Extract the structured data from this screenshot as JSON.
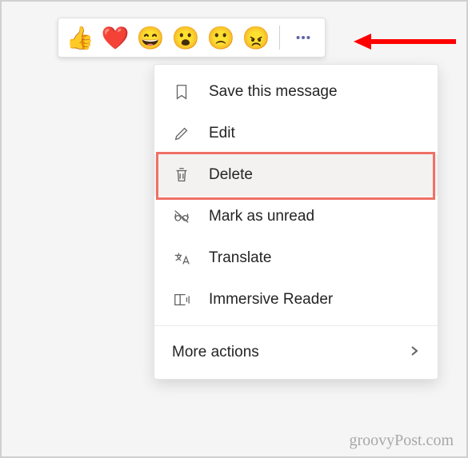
{
  "reactions": {
    "items": [
      {
        "name": "thumbs-up",
        "glyph": "👍"
      },
      {
        "name": "heart",
        "glyph": "❤️"
      },
      {
        "name": "laugh",
        "glyph": "😄"
      },
      {
        "name": "surprised",
        "glyph": "😮"
      },
      {
        "name": "sad",
        "glyph": "🙁"
      },
      {
        "name": "angry",
        "glyph": "😠"
      }
    ],
    "more_color": "#6264a7"
  },
  "menu": {
    "items": [
      {
        "id": "save",
        "label": "Save this message"
      },
      {
        "id": "edit",
        "label": "Edit"
      },
      {
        "id": "delete",
        "label": "Delete",
        "highlighted": true
      },
      {
        "id": "mark-unread",
        "label": "Mark as unread"
      },
      {
        "id": "translate",
        "label": "Translate"
      },
      {
        "id": "immersive-reader",
        "label": "Immersive Reader"
      }
    ],
    "more_actions_label": "More actions"
  },
  "annotation": {
    "arrow_color": "#ff0000",
    "highlight_color": "#f07066"
  },
  "watermark": "groovyPost.com"
}
